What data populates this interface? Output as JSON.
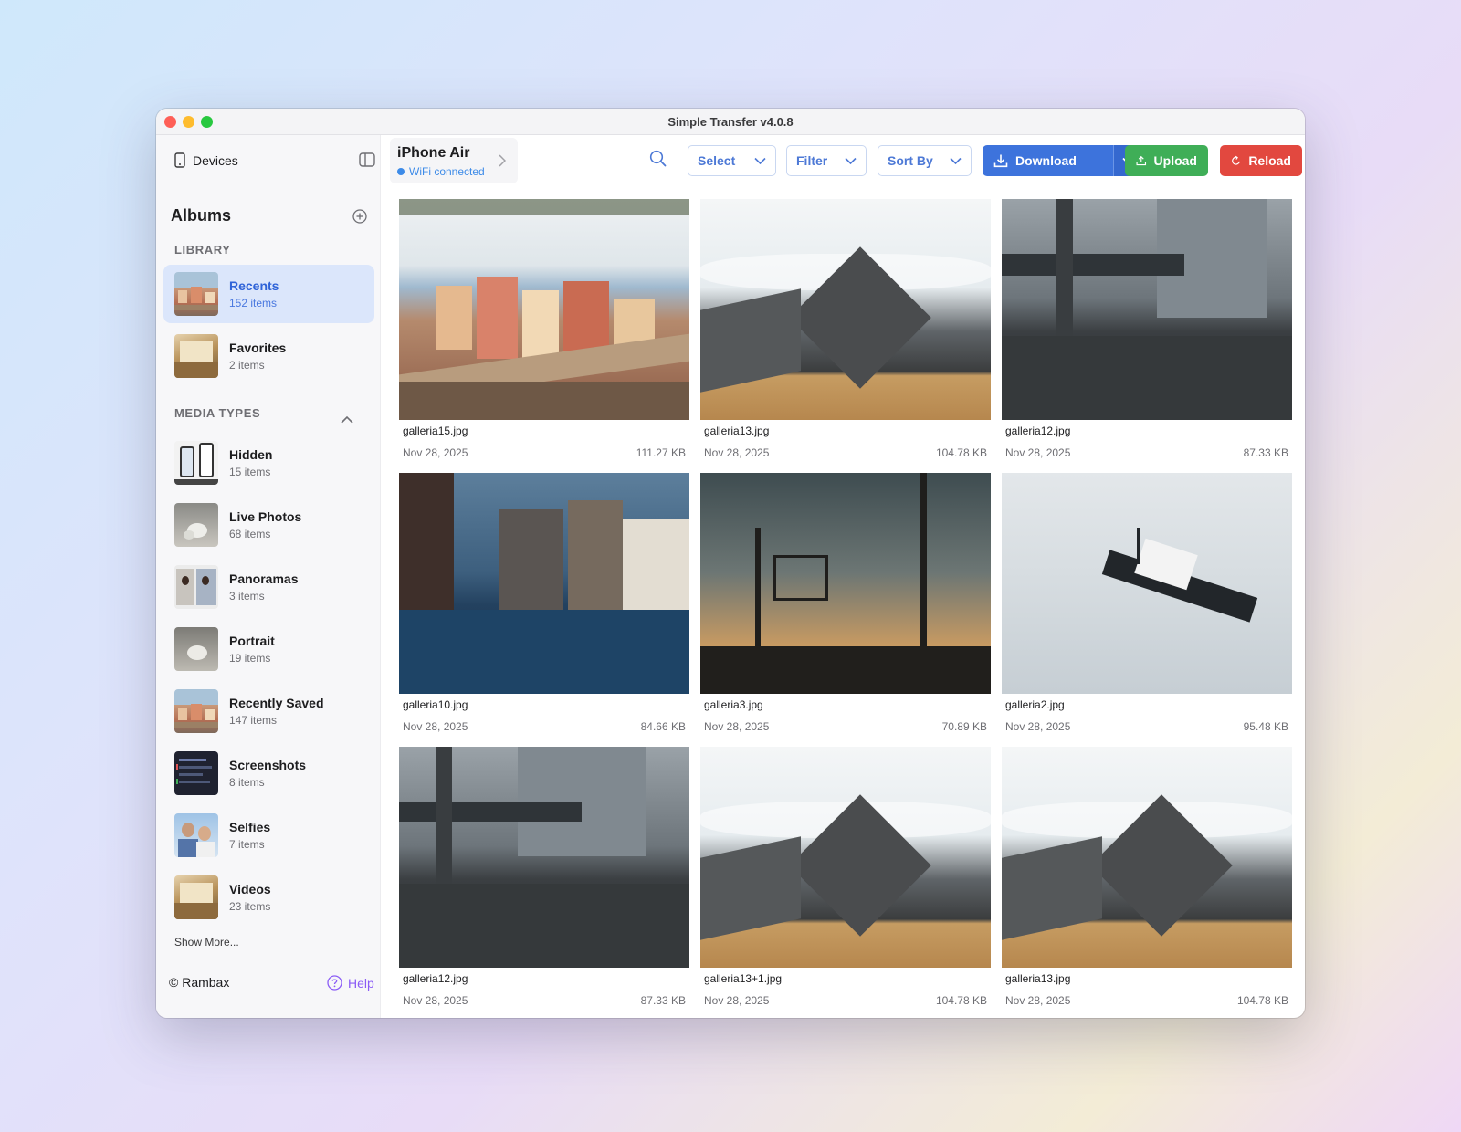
{
  "window": {
    "title": "Simple Transfer v4.0.8"
  },
  "sidebar": {
    "devices_label": "Devices",
    "albums_heading": "Albums",
    "library_heading": "LIBRARY",
    "library_items": [
      {
        "name": "Recents",
        "count": "152 items",
        "active": true
      },
      {
        "name": "Favorites",
        "count": "2 items",
        "active": false
      }
    ],
    "media_heading": "MEDIA TYPES",
    "media_items": [
      {
        "name": "Hidden",
        "count": "15 items"
      },
      {
        "name": "Live Photos",
        "count": "68 items"
      },
      {
        "name": "Panoramas",
        "count": "3 items"
      },
      {
        "name": "Portrait",
        "count": "19 items"
      },
      {
        "name": "Recently Saved",
        "count": "147 items"
      },
      {
        "name": "Screenshots",
        "count": "8 items"
      },
      {
        "name": "Selfies",
        "count": "7 items"
      },
      {
        "name": "Videos",
        "count": "23 items"
      }
    ],
    "show_more": "Show More...",
    "copyright": "© Rambax",
    "help": "Help"
  },
  "toolbar": {
    "device_name": "iPhone Air",
    "device_status": "WiFi connected",
    "select_label": "Select",
    "filter_label": "Filter",
    "sort_label": "Sort By",
    "download_label": "Download",
    "upload_label": "Upload",
    "reload_label": "Reload"
  },
  "colors": {
    "accent": "#3d73dc",
    "upload": "#3fae57",
    "reload": "#e2483f",
    "help": "#8b5cf6",
    "status": "#3d8be8"
  },
  "photos": [
    {
      "filename": "galleria15.jpg",
      "date": "Nov 28, 2025",
      "size": "111.27 KB"
    },
    {
      "filename": "galleria13.jpg",
      "date": "Nov 28, 2025",
      "size": "104.78 KB"
    },
    {
      "filename": "galleria12.jpg",
      "date": "Nov 28, 2025",
      "size": "87.33 KB"
    },
    {
      "filename": "galleria10.jpg",
      "date": "Nov 28, 2025",
      "size": "84.66 KB"
    },
    {
      "filename": "galleria3.jpg",
      "date": "Nov 28, 2025",
      "size": "70.89 KB"
    },
    {
      "filename": "galleria2.jpg",
      "date": "Nov 28, 2025",
      "size": "95.48 KB"
    },
    {
      "filename": "galleria12.jpg",
      "date": "Nov 28, 2025",
      "size": "87.33 KB"
    },
    {
      "filename": "galleria13+1.jpg",
      "date": "Nov 28, 2025",
      "size": "104.78 KB"
    },
    {
      "filename": "galleria13.jpg",
      "date": "Nov 28, 2025",
      "size": "104.78 KB"
    }
  ]
}
